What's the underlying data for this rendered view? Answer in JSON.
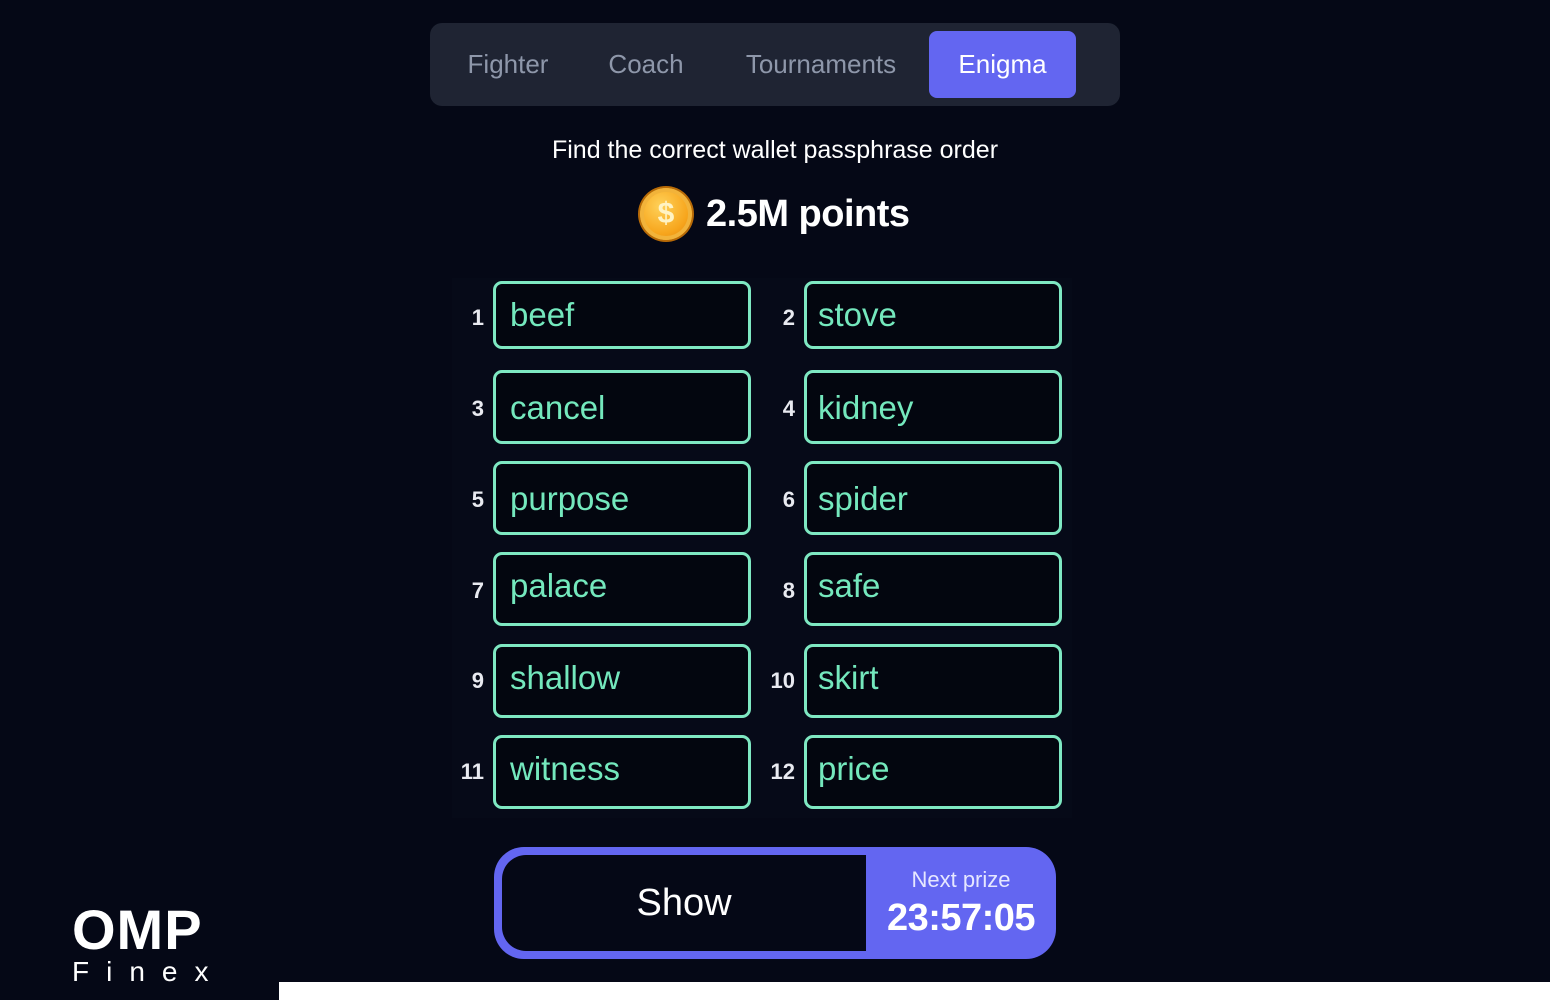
{
  "tabs": [
    {
      "label": "Fighter",
      "active": false
    },
    {
      "label": "Coach",
      "active": false
    },
    {
      "label": "Tournaments",
      "active": false
    },
    {
      "label": "Enigma",
      "active": true
    }
  ],
  "instruction": "Find the correct wallet passphrase order",
  "reward": {
    "icon": "coin-dollar-icon",
    "points_label": "2.5M points",
    "coin_symbol": "$"
  },
  "words": [
    {
      "n": "1",
      "word": "beef"
    },
    {
      "n": "2",
      "word": "stove"
    },
    {
      "n": "3",
      "word": "cancel"
    },
    {
      "n": "4",
      "word": "kidney"
    },
    {
      "n": "5",
      "word": "purpose"
    },
    {
      "n": "6",
      "word": "spider"
    },
    {
      "n": "7",
      "word": "palace"
    },
    {
      "n": "8",
      "word": "safe"
    },
    {
      "n": "9",
      "word": "shallow"
    },
    {
      "n": "10",
      "word": "skirt"
    },
    {
      "n": "11",
      "word": "witness"
    },
    {
      "n": "12",
      "word": "price"
    }
  ],
  "action": {
    "show_label": "Show",
    "next_prize_label": "Next prize",
    "countdown": "23:57:05"
  },
  "branding": {
    "logo_main": "OMP",
    "logo_sub": "Finex"
  },
  "colors": {
    "background": "#050816",
    "accent": "#6366f1",
    "word_border": "#7ee8c2",
    "word_text": "#74e8bd"
  }
}
